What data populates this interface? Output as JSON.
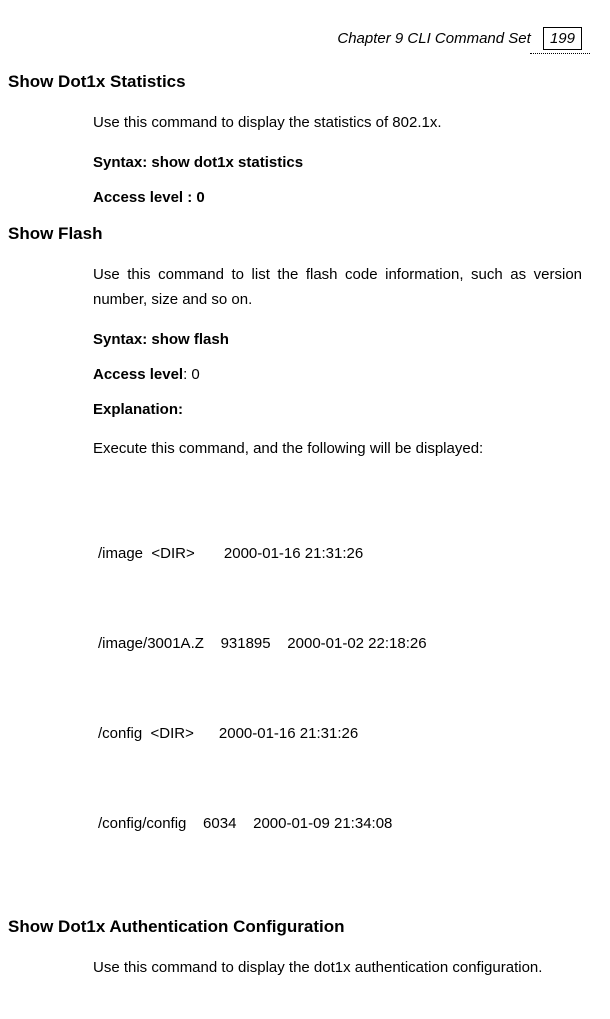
{
  "header": {
    "chapter": "Chapter 9 CLI Command Set",
    "page": "199"
  },
  "s1": {
    "title": "Show Dot1x Statistics",
    "desc": "Use this command to display the statistics of 802.1x.",
    "syntax_label": "Syntax:  show dot1x  statistics",
    "access_label": "Access level : 0"
  },
  "s2": {
    "title": "Show Flash",
    "desc": "Use this command to list the flash code information, such as version number, size and so on.",
    "syntax_label": "Syntax: show flash",
    "access_prefix": "Access level",
    "access_value": ": 0",
    "explanation_label": "Explanation:",
    "exec_text": "Execute this command, and the following will be displayed:",
    "lines": {
      "l1": "/image  <DIR>       2000-01-16 21:31:26",
      "l2": "/image/3001A.Z    931895    2000-01-02 22:18:26",
      "l3": "/config  <DIR>      2000-01-16 21:31:26",
      "l4": "/config/config    6034    2000-01-09 21:34:08"
    }
  },
  "s3": {
    "title": "Show  Dot1x Authentication Configuration",
    "desc": "Use this command to display the dot1x authentication configuration."
  }
}
